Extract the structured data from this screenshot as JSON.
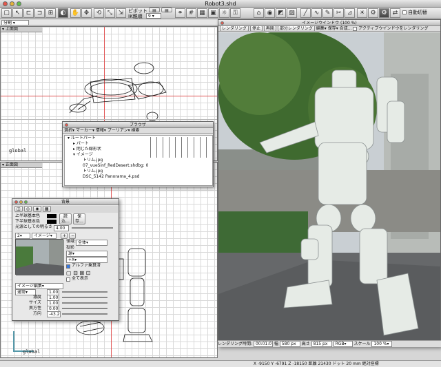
{
  "window": {
    "title": "Robot3.shd"
  },
  "toolbar": {
    "pivot_label": "ピボット",
    "ik_label": "IK親順",
    "ik_value": "9",
    "auto_switch_label": "自動切替"
  },
  "left_panel": {
    "split_label": "分割",
    "top_view_label": "上面図",
    "front_view_label": "正面図",
    "global_label_top": "global",
    "global_label_bottom": "global"
  },
  "render_window": {
    "title": "イメージウインドウ (100 %)",
    "menu": [
      "レンダリング",
      "停止",
      "再開",
      "部分レンダリング",
      "編集",
      "保存",
      "合成..."
    ],
    "active_checkbox_label": "アクティブウインドウをレンダリング",
    "status": {
      "time_label": "レンダリング時間:",
      "time_value": "00:01:07",
      "width_label": "幅",
      "width_value": "580 px",
      "height_label": "高さ",
      "height_value": "815 px",
      "color_mode": "RGB",
      "scale_label": "スケール",
      "scale_value": "100 %"
    }
  },
  "browser": {
    "title": "ブラウザ",
    "menu": [
      "選択",
      "マーカー",
      "情報",
      "プーリアン",
      "検索"
    ],
    "tree": [
      {
        "label": "ルートパート",
        "indent": 0
      },
      {
        "label": "パート",
        "indent": 1
      },
      {
        "label": "閉じた線形状",
        "indent": 1
      },
      {
        "label": "イメージ",
        "indent": 1
      },
      {
        "label": "トリム.jpg",
        "indent": 2
      },
      {
        "label": "07_vueSinf_RedDesert.shdbg: 0",
        "indent": 2
      },
      {
        "label": "トリム.jpg",
        "indent": 2
      },
      {
        "label": "DSC_5142 Panorama_4.psd",
        "indent": 2
      }
    ]
  },
  "background_panel": {
    "title": "背景",
    "upper_color_label": "上半球基本色",
    "lower_color_label": "下半球基本色",
    "read_button": "読込...",
    "save_button": "保存...",
    "brightness_label": "光源としての明るさ",
    "brightness_value": "4.00",
    "layer_index": "2",
    "layer_type": "イメージ",
    "area_label": "領域:",
    "area_value": "全体",
    "projection_label": "投影",
    "projection_value": "球",
    "axis_value": "+X",
    "alpha_label": "アルファ乗算済",
    "show_all_label": "全て表示",
    "edit_menu": "イメージ編集",
    "blend_mode": "通常",
    "params": [
      {
        "label": "濃度",
        "value": "1.00"
      },
      {
        "label": "サイズ",
        "value": "1.00"
      },
      {
        "label": "異方性",
        "value": "0.00"
      },
      {
        "label": "方向",
        "value": "-43.20"
      }
    ],
    "first_value": "1.00"
  },
  "coordinates": {
    "x_label": "X",
    "x_value": "-9150",
    "y_label": "Y",
    "y_value": "-6791",
    "z_label": "Z",
    "z_value": "-18150",
    "distance_label": "距離",
    "distance_value": "21430",
    "dot_label": "ドット",
    "dot_value": "20",
    "absolute_label": "mm",
    "absolute_coords": "絶対座標"
  }
}
